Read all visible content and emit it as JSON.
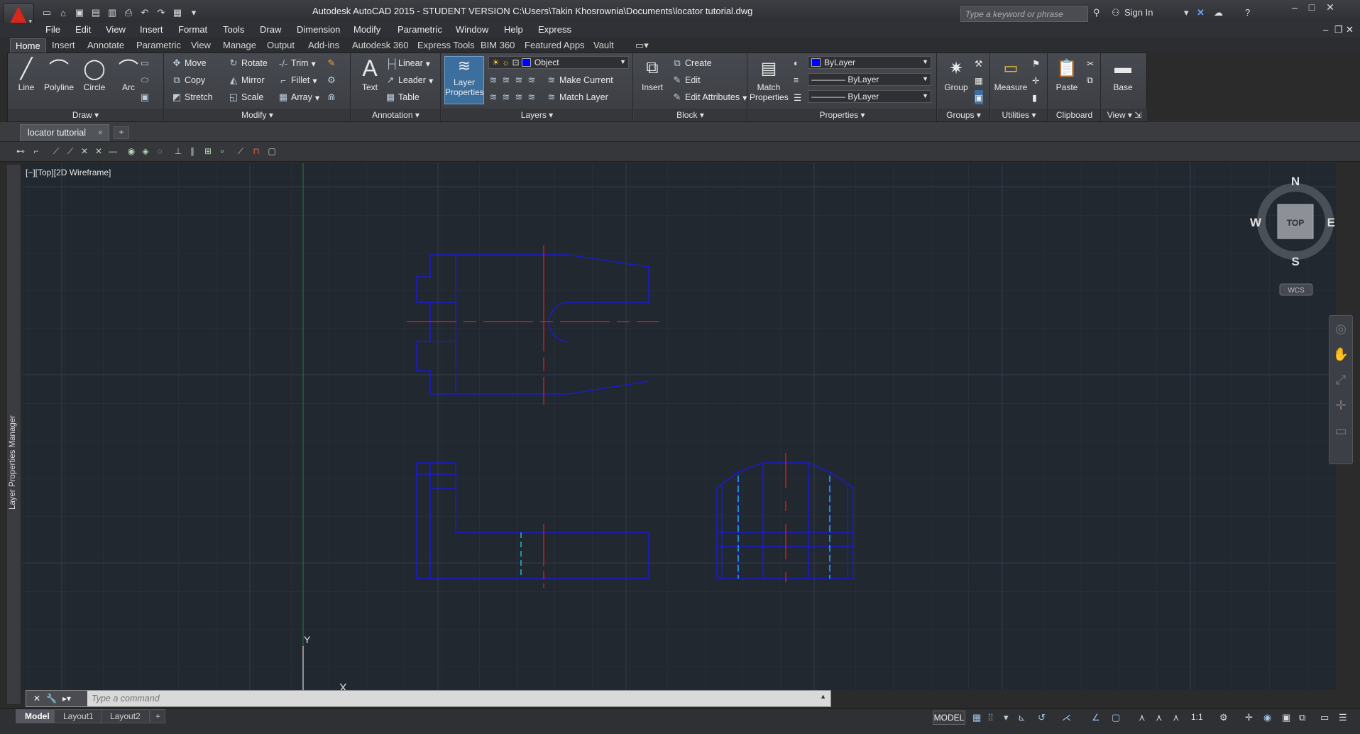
{
  "titlebar": {
    "title": "Autodesk AutoCAD 2015 - STUDENT VERSION     C:\\Users\\Takin Khosrownia\\Documents\\locator tutorial.dwg",
    "search_placeholder": "Type a keyword or phrase",
    "sign_in": "Sign In",
    "quick_access": [
      "new-icon",
      "open-icon",
      "save-icon",
      "save-as-icon",
      "plot-icon",
      "print-icon",
      "undo-icon",
      "redo-icon",
      "workspace-icon",
      "more-icon"
    ]
  },
  "menubar": [
    "File",
    "Edit",
    "View",
    "Insert",
    "Format",
    "Tools",
    "Draw",
    "Dimension",
    "Modify",
    "Parametric",
    "Window",
    "Help",
    "Express"
  ],
  "ribbon_tabs": [
    "Home",
    "Insert",
    "Annotate",
    "Parametric",
    "View",
    "Manage",
    "Output",
    "Add-ins",
    "Autodesk 360",
    "Express Tools",
    "BIM 360",
    "Featured Apps",
    "Vault"
  ],
  "ribbon": {
    "draw": {
      "title": "Draw",
      "line": "Line",
      "polyline": "Polyline",
      "circle": "Circle",
      "arc": "Arc"
    },
    "modify": {
      "title": "Modify",
      "move": "Move",
      "rotate": "Rotate",
      "trim": "Trim",
      "copy": "Copy",
      "mirror": "Mirror",
      "fillet": "Fillet",
      "stretch": "Stretch",
      "scale": "Scale",
      "array": "Array"
    },
    "annotation": {
      "title": "Annotation",
      "text": "Text",
      "linear": "Linear",
      "leader": "Leader",
      "table": "Table"
    },
    "layers": {
      "title": "Layers",
      "layer_properties": "Layer Properties",
      "current_layer": "Object",
      "make_current": "Make Current",
      "match_layer": "Match Layer"
    },
    "block": {
      "title": "Block",
      "insert": "Insert",
      "create": "Create",
      "edit": "Edit",
      "edit_attributes": "Edit Attributes"
    },
    "properties": {
      "title": "Properties",
      "match_properties": "Match Properties",
      "color": "ByLayer",
      "linetype": "ByLayer",
      "lineweight": "ByLayer"
    },
    "groups": {
      "title": "Groups",
      "group": "Group"
    },
    "utilities": {
      "title": "Utilities",
      "measure": "Measure"
    },
    "clipboard": {
      "title": "Clipboard",
      "paste": "Paste"
    },
    "view": {
      "title": "View",
      "base": "Base"
    }
  },
  "file_tab": {
    "name": "locator tuttorial",
    "close": "×",
    "new": "+"
  },
  "viewport": {
    "label": "[−][Top][2D Wireframe]",
    "ucs_y": "Y",
    "ucs_x": "X"
  },
  "viewcube": {
    "n": "N",
    "s": "S",
    "e": "E",
    "w": "W",
    "top": "TOP",
    "wcs": "WCS"
  },
  "side_panel": {
    "label": "Layer Properties Manager"
  },
  "command_line": {
    "placeholder": "Type a command"
  },
  "status": {
    "model": "MODEL",
    "scale": "1:1",
    "layout_tabs": [
      "Model",
      "Layout1",
      "Layout2"
    ],
    "add": "+"
  },
  "colors": {
    "outline": "#1c1cc8",
    "centerline": "#d41e1e",
    "hidden": "#22b8d0",
    "background": "#212830"
  }
}
